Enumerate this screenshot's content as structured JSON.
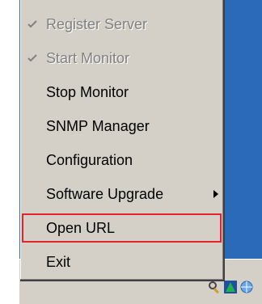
{
  "context_menu": {
    "items": [
      {
        "label": "Register Server",
        "checked": true,
        "enabled": false
      },
      {
        "label": "Start Monitor",
        "checked": true,
        "enabled": false
      },
      {
        "label": "Stop Monitor",
        "checked": false,
        "enabled": true
      },
      {
        "label": "SNMP Manager",
        "checked": false,
        "enabled": true
      },
      {
        "label": "Configuration",
        "checked": false,
        "enabled": true
      },
      {
        "label": "Software Upgrade",
        "checked": false,
        "enabled": true,
        "has_submenu": true
      },
      {
        "label": "Open URL",
        "checked": false,
        "enabled": true,
        "highlighted": true
      },
      {
        "label": "Exit",
        "checked": false,
        "enabled": true
      }
    ]
  },
  "colors": {
    "menu_bg": "#d4d0c8",
    "desktop_bg": "#2a6ab8",
    "highlight_border": "#e0232c",
    "disabled_text": "#808080"
  },
  "tray": {
    "icons": [
      "magnifier-key-icon",
      "green-arrow-icon",
      "network-globe-icon"
    ]
  }
}
